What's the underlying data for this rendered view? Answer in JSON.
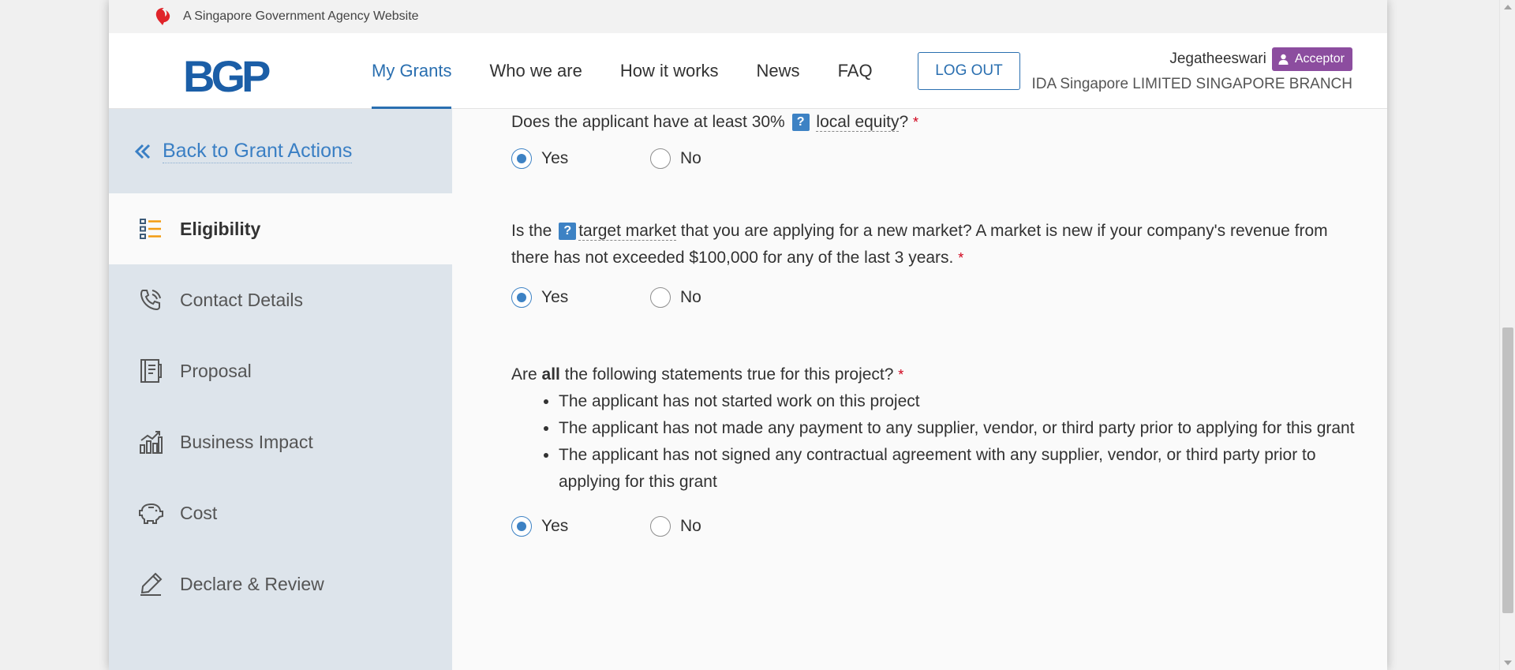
{
  "gov_banner": {
    "text": "A Singapore Government Agency Website",
    "icon": "lion-head-icon"
  },
  "header": {
    "logo": "BGP",
    "nav": [
      {
        "label": "My Grants",
        "active": true
      },
      {
        "label": "Who we are",
        "active": false
      },
      {
        "label": "How it works",
        "active": false
      },
      {
        "label": "News",
        "active": false
      },
      {
        "label": "FAQ",
        "active": false
      }
    ],
    "logout_label": "LOG OUT",
    "user_name": "Jegatheeswari",
    "role": "Acceptor",
    "org": "IDA Singapore LIMITED SINGAPORE BRANCH"
  },
  "sidebar": {
    "back_label": "Back to Grant Actions",
    "items": [
      {
        "label": "Eligibility",
        "icon": "list-icon",
        "active": true
      },
      {
        "label": "Contact Details",
        "icon": "phone-icon",
        "active": false
      },
      {
        "label": "Proposal",
        "icon": "document-icon",
        "active": false
      },
      {
        "label": "Business Impact",
        "icon": "bar-chart-icon",
        "active": false
      },
      {
        "label": "Cost",
        "icon": "piggy-bank-icon",
        "active": false
      },
      {
        "label": "Declare & Review",
        "icon": "pen-icon",
        "active": false
      }
    ]
  },
  "questions": {
    "q1": {
      "text_before": "Does the applicant have at least 30%",
      "help": "?",
      "term": "local equity",
      "text_after": "?",
      "required": "*",
      "selected": "Yes"
    },
    "q2": {
      "text_before": "Is the",
      "help": "?",
      "term": "target market",
      "text_after": " that you are applying for a new market? A market is new if your company's revenue from there has not exceeded $100,000 for any of the last 3 years.",
      "required": "*",
      "selected": "Yes"
    },
    "q3": {
      "text_before": "Are",
      "bold": "all",
      "text_after": "the following statements true for this project?",
      "required": "*",
      "bullets": [
        "The applicant has not started work on this project",
        "The applicant has not made any payment to any supplier, vendor, or third party prior to applying for this grant",
        "The applicant has not signed any contractual agreement with any supplier, vendor, or third party prior to applying for this grant"
      ],
      "selected": "Yes"
    },
    "yes_label": "Yes",
    "no_label": "No"
  },
  "colors": {
    "primary": "#2a6fb0",
    "role_badge": "#8c4d9f",
    "required": "#d0021b",
    "sidebar_bg": "#dde4eb"
  }
}
